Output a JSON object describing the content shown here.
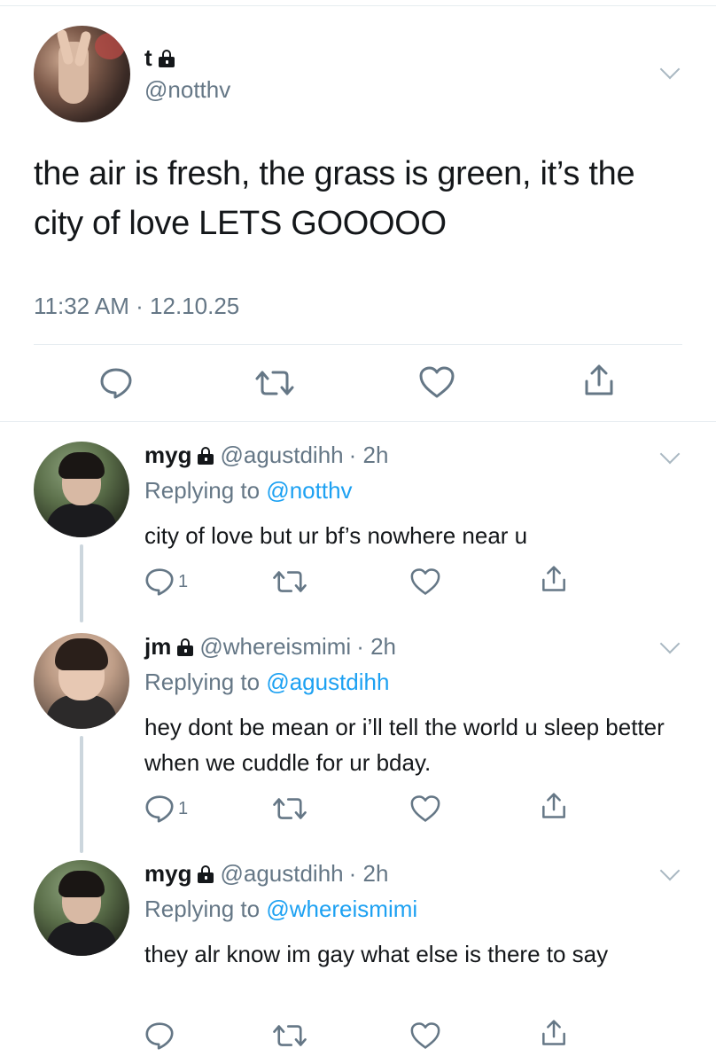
{
  "main_tweet": {
    "name": "t",
    "handle": "@notthv",
    "text": "the air is fresh, the grass is green, it’s the city of love LETS GOOOOO",
    "meta": "11:32 AM · 12.10.25",
    "avatar_icon": "peace-sign-hand",
    "locked": true
  },
  "replies": [
    {
      "name": "myg",
      "handle": "@agustdihh",
      "time": "· 2h",
      "replying_prefix": "Replying to ",
      "replying_to": "@notthv",
      "text": "city of love but ur bf’s nowhere near u",
      "reply_count": "1"
    },
    {
      "name": "jm",
      "handle": "@whereismimi",
      "time": "· 2h",
      "replying_prefix": "Replying to ",
      "replying_to": "@agustdihh",
      "text": "hey dont be mean or i’ll tell the world u sleep better when we cuddle for ur bday.",
      "reply_count": "1"
    },
    {
      "name": "myg",
      "handle": "@agustdihh",
      "time": "· 2h",
      "replying_prefix": "Replying to ",
      "replying_to": "@whereismimi",
      "text": "they alr know im gay what else is there to say",
      "reply_count": ""
    }
  ],
  "icons": {
    "reply": "reply-icon",
    "retweet": "retweet-icon",
    "like": "heart-icon",
    "share": "share-icon",
    "lock": "lock-icon",
    "more": "chevron-down-icon"
  },
  "colors": {
    "text": "#14171a",
    "muted": "#657786",
    "link": "#1da1f2",
    "divider": "#e6ecf0",
    "thread_line": "#ccd6dd"
  }
}
